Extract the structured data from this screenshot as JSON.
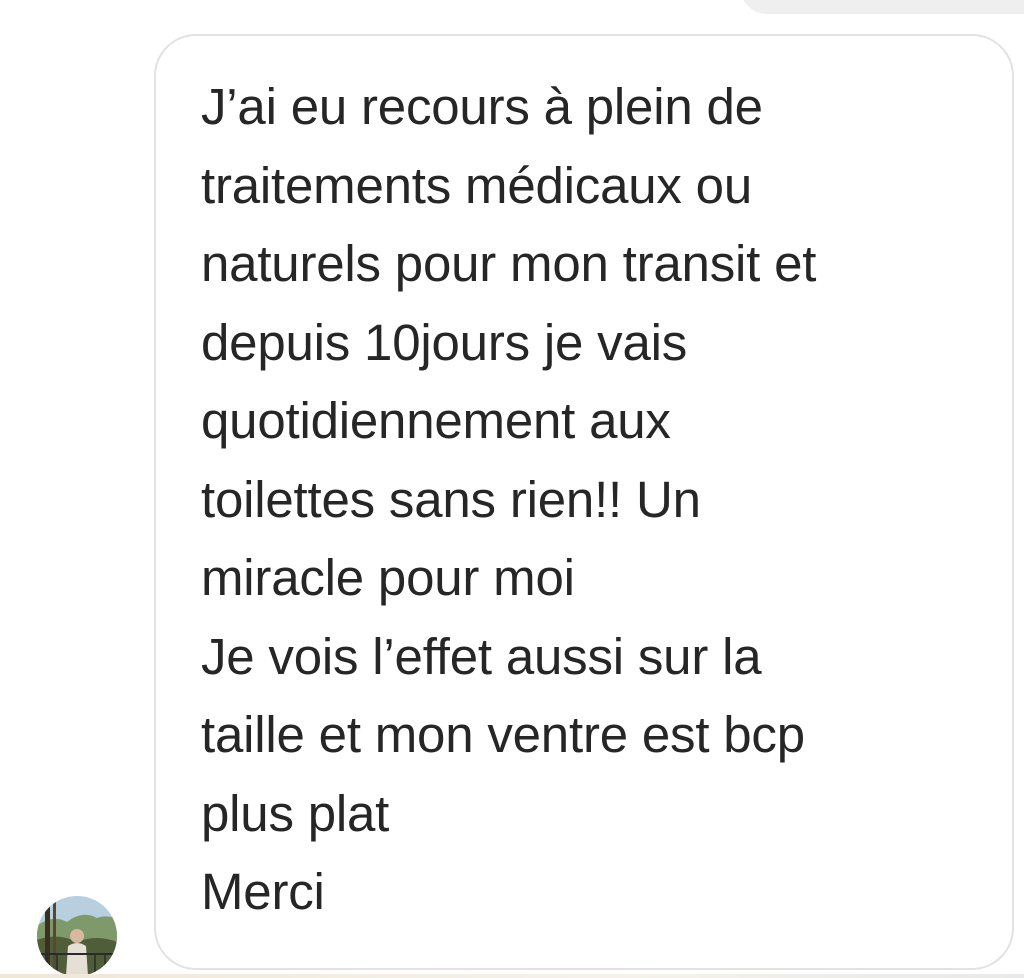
{
  "conversation": {
    "previous_bubble": {
      "color": "#efefef"
    },
    "message": {
      "lines": [
        "J’ai eu recours à plein de",
        "traitements médicaux ou",
        "naturels pour mon transit et",
        "depuis 10jours je vais",
        "quotidiennement aux",
        "toilettes sans rien!! Un",
        "miracle pour moi",
        "Je vois l’effet aussi sur la",
        "taille et mon ventre est bcp",
        "plus plat",
        "Merci"
      ],
      "text_color": "#262626",
      "border_color": "#e2e2e2"
    },
    "sender": {
      "avatar_icon": "profile-photo-avatar"
    }
  }
}
